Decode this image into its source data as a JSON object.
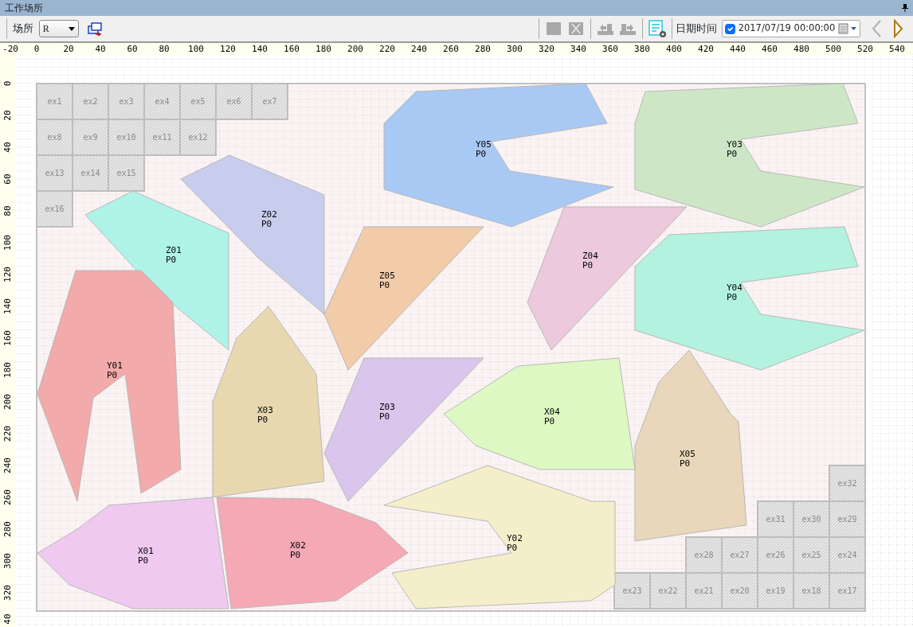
{
  "panel": {
    "title": "工作场所"
  },
  "toolbar": {
    "site_label": "场所",
    "site_value": "R",
    "datetime_label": "日期时间",
    "datetime": {
      "checked": true,
      "value": "2017/07/19 00:00:00"
    },
    "tools": [
      {
        "kind": "swap"
      },
      {
        "kind": "stop",
        "disabled": true
      },
      {
        "kind": "delete",
        "disabled": true
      },
      {
        "kind": "undo",
        "disabled": true
      },
      {
        "kind": "redo",
        "disabled": true
      },
      {
        "kind": "settings"
      },
      {
        "kind": "prev",
        "disabled": true
      },
      {
        "kind": "next",
        "disabled": false
      }
    ]
  },
  "rulers": {
    "x_labels": [
      "-20",
      "0",
      "20",
      "40",
      "60",
      "80",
      "100",
      "120",
      "140",
      "160",
      "180",
      "200",
      "220",
      "240",
      "260",
      "280",
      "300",
      "320",
      "340",
      "360",
      "380",
      "400",
      "420",
      "440",
      "460",
      "480",
      "500",
      "520",
      "540"
    ],
    "y_labels": [
      "0",
      "20",
      "40",
      "60",
      "80",
      "100",
      "120",
      "140",
      "160",
      "180",
      "200",
      "220",
      "240",
      "260",
      "280",
      "300",
      "320",
      "40"
    ]
  },
  "shapes": [
    {
      "name": "Y05",
      "sub": "P0",
      "color": "#a9c9f5"
    },
    {
      "name": "Y03",
      "sub": "P0",
      "color": "#cde7c6"
    },
    {
      "name": "Z02",
      "sub": "P0",
      "color": "#c8cdee"
    },
    {
      "name": "Z04",
      "sub": "P0",
      "color": "#ecc9dc"
    },
    {
      "name": "Z01",
      "sub": "P0",
      "color": "#aff3e8"
    },
    {
      "name": "Z05",
      "sub": "P0",
      "color": "#f2cba9"
    },
    {
      "name": "Y04",
      "sub": "P0",
      "color": "#b2f2df"
    },
    {
      "name": "Y01",
      "sub": "P0",
      "color": "#f2aaaa"
    },
    {
      "name": "X03",
      "sub": "P0",
      "color": "#e8d8b0"
    },
    {
      "name": "Z03",
      "sub": "P0",
      "color": "#dac5ec"
    },
    {
      "name": "X04",
      "sub": "P0",
      "color": "#ddf8c3"
    },
    {
      "name": "X05",
      "sub": "P0",
      "color": "#e8d7bb"
    },
    {
      "name": "X01",
      "sub": "P0",
      "color": "#efc9ef"
    },
    {
      "name": "X02",
      "sub": "P0",
      "color": "#f5a9b4"
    },
    {
      "name": "Y02",
      "sub": "P0",
      "color": "#f4efca"
    }
  ],
  "slots": [
    {
      "label": "ex1"
    },
    {
      "label": "ex2"
    },
    {
      "label": "ex3"
    },
    {
      "label": "ex4"
    },
    {
      "label": "ex5"
    },
    {
      "label": "ex6"
    },
    {
      "label": "ex7"
    },
    {
      "label": "ex8"
    },
    {
      "label": "ex9"
    },
    {
      "label": "ex10"
    },
    {
      "label": "ex11"
    },
    {
      "label": "ex12"
    },
    {
      "label": "ex13"
    },
    {
      "label": "ex14"
    },
    {
      "label": "ex15"
    },
    {
      "label": "ex16"
    },
    {
      "label": "ex32"
    },
    {
      "label": "ex31"
    },
    {
      "label": "ex30"
    },
    {
      "label": "ex29"
    },
    {
      "label": "ex28"
    },
    {
      "label": "ex27"
    },
    {
      "label": "ex26"
    },
    {
      "label": "ex25"
    },
    {
      "label": "ex24"
    },
    {
      "label": "ex23"
    },
    {
      "label": "ex22"
    },
    {
      "label": "ex21"
    },
    {
      "label": "ex20"
    },
    {
      "label": "ex19"
    },
    {
      "label": "ex18"
    },
    {
      "label": "ex17"
    }
  ]
}
